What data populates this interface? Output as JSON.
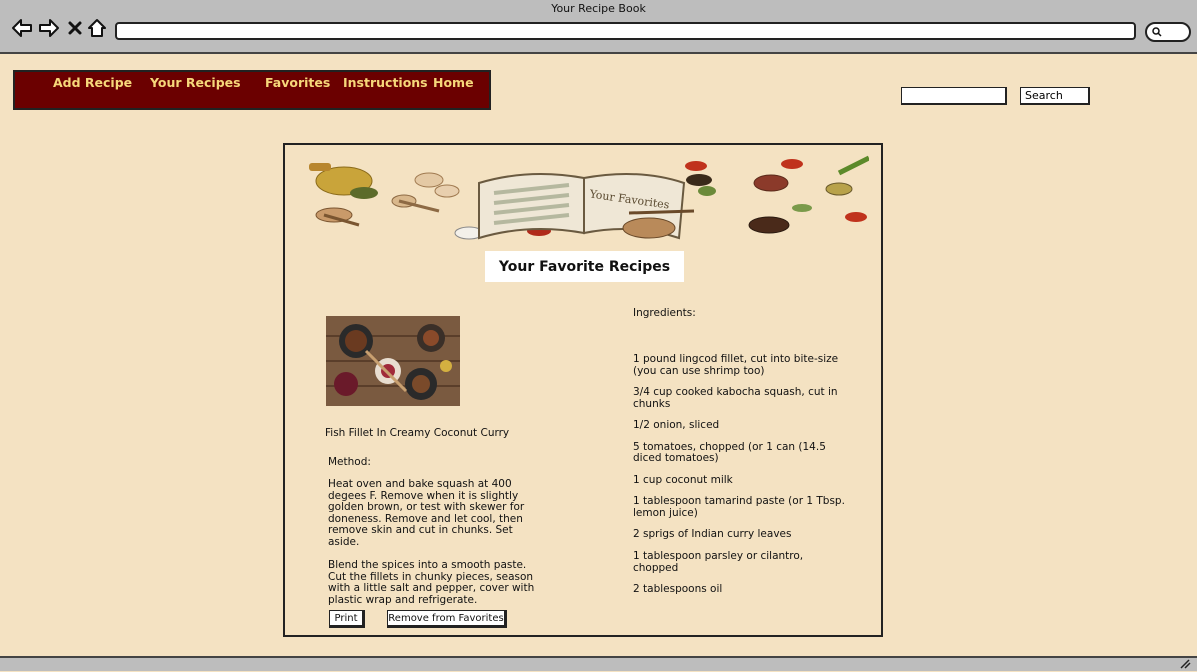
{
  "window": {
    "title": "Your Recipe Book"
  },
  "browser": {
    "back_icon": "back-arrow-icon",
    "forward_icon": "forward-arrow-icon",
    "close_icon": "close-icon",
    "home_icon": "home-icon",
    "search_icon": "search-icon"
  },
  "nav": {
    "items": [
      {
        "label": "Add Recipe"
      },
      {
        "label": "Your Recipes"
      },
      {
        "label": "Favorites"
      },
      {
        "label": "Instructions"
      },
      {
        "label": "Home"
      }
    ]
  },
  "search": {
    "value": "",
    "button_label": "Search"
  },
  "banner": {
    "book_title": "Your Favorites"
  },
  "page": {
    "title": "Your Favorite Recipes"
  },
  "recipe": {
    "name": "Fish Fillet In Creamy Coconut Curry",
    "method_label": "Method:",
    "method": [
      "Heat oven and bake squash at 400 degees F. Remove when it is slightly golden brown, or test with skewer for doneness. Remove and let cool, then remove skin and cut in chunks. Set aside.",
      "Blend the spices into a smooth paste. Cut the fillets in chunky pieces, season with a little salt and pepper, cover with plastic wrap and refrigerate."
    ],
    "ingredients_label": "Ingredients:",
    "ingredients": [
      "1 pound lingcod fillet, cut into bite-size (you can use shrimp too)",
      "3/4 cup cooked kabocha squash, cut in chunks",
      "1/2 onion, sliced",
      "5 tomatoes, chopped (or 1 can (14.5 diced tomatoes)",
      "1 cup coconut milk",
      "1 tablespoon tamarind paste (or 1 Tbsp. lemon juice)",
      "2 sprigs of Indian curry leaves",
      "1 tablespoon parsley or cilantro, chopped",
      "2 tablespoons oil"
    ]
  },
  "actions": {
    "print_label": "Print",
    "remove_label": "Remove from Favorites"
  },
  "colors": {
    "background": "#f4e2c2",
    "nav_bg": "#6b0000",
    "nav_text": "#f6d77a"
  }
}
